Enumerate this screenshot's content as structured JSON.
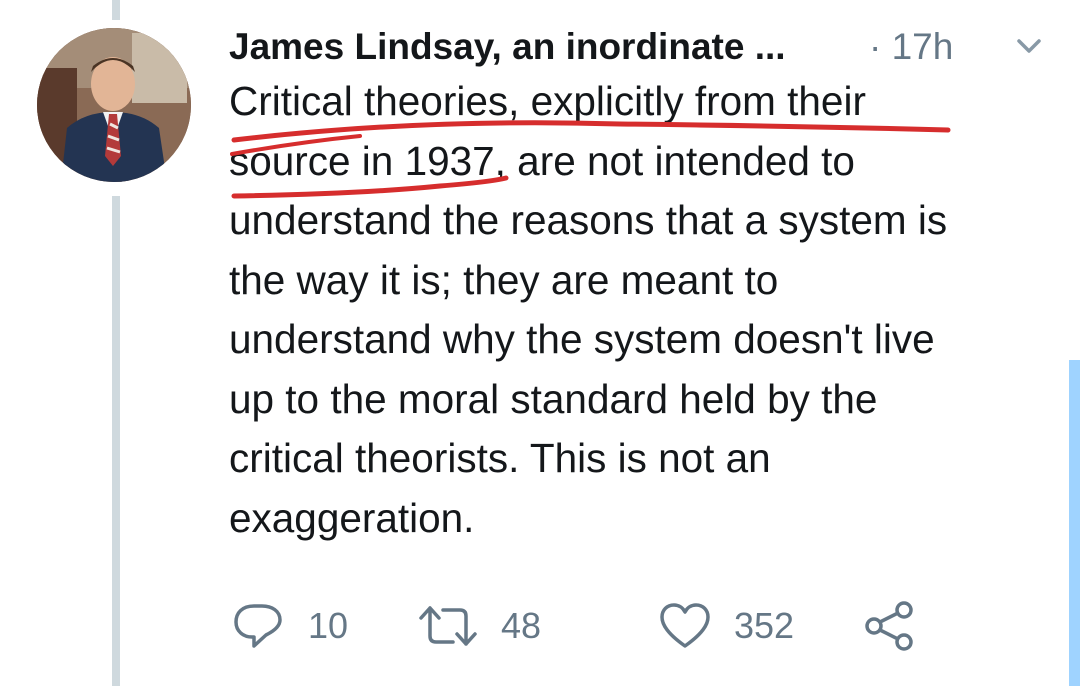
{
  "tweet": {
    "author_name": "James Lindsay, an inordinate ...",
    "timestamp": "· 17h",
    "lines": [
      "Critical theories, explicitly from their",
      "source in 1937, are not intended to",
      "understand the reasons that a system is",
      "the way it is; they are meant to",
      "understand why the system doesn't live",
      "up to the moral standard held by the",
      "critical theorists. This is not an",
      "exaggeration."
    ],
    "annotation_color": "#d62d2d"
  },
  "actions": {
    "reply_count": "10",
    "retweet_count": "48",
    "like_count": "352",
    "reply_icon": "speech-bubble-icon",
    "retweet_icon": "retweet-arrows-icon",
    "like_icon": "heart-icon",
    "share_icon": "share-nodes-icon"
  },
  "colors": {
    "text": "#14171a",
    "secondary_text": "#657786",
    "thread_line": "#cfd9de",
    "scrollbar": "#9fd3ff"
  }
}
